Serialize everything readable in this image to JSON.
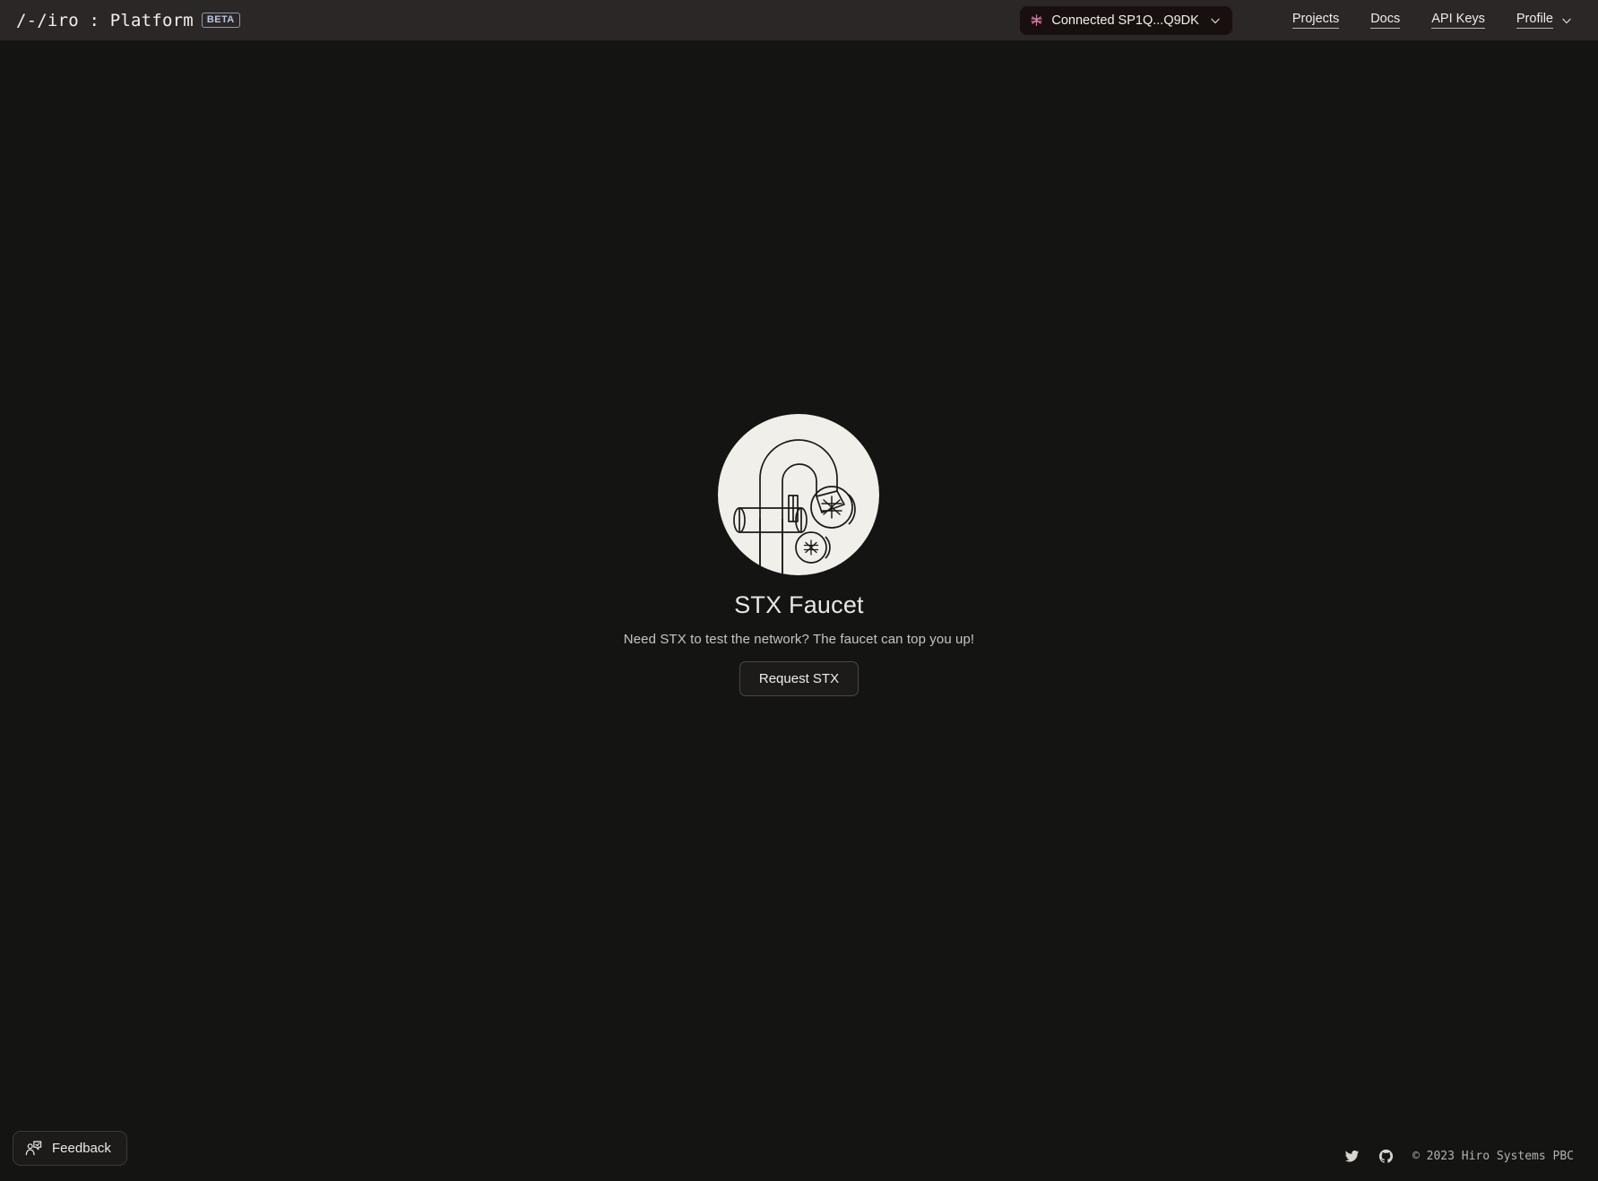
{
  "header": {
    "brand": {
      "logo_text": "/-/iro : Platform",
      "badge": "BETA"
    },
    "wallet": {
      "icon": "stacks-icon",
      "label": "Connected SP1Q...Q9DK",
      "chevron": "chevron-down-icon",
      "accent_color": "#d67aa8",
      "background": "#17100f"
    },
    "nav": [
      {
        "label": "Projects",
        "name": "projects"
      },
      {
        "label": "Docs",
        "name": "docs"
      },
      {
        "label": "API Keys",
        "name": "api-keys"
      }
    ],
    "profile": {
      "label": "Profile",
      "chevron": "chevron-down-icon"
    },
    "background": "#2a2726"
  },
  "main": {
    "illustration": {
      "name": "stx-faucet-illustration",
      "description": "faucet with STX coins",
      "circle_color": "#f0efe9",
      "line_color": "#1b1a18"
    },
    "title": "STX Faucet",
    "subtitle": "Need STX to test the network? The faucet can top you up!",
    "request_button": "Request STX",
    "background": "#141413"
  },
  "footer": {
    "feedback_button": {
      "label": "Feedback",
      "icon": "feedback-person-icon"
    },
    "social": [
      {
        "name": "twitter-icon"
      },
      {
        "name": "github-icon"
      }
    ],
    "copyright": "© 2023 Hiro Systems PBC"
  }
}
